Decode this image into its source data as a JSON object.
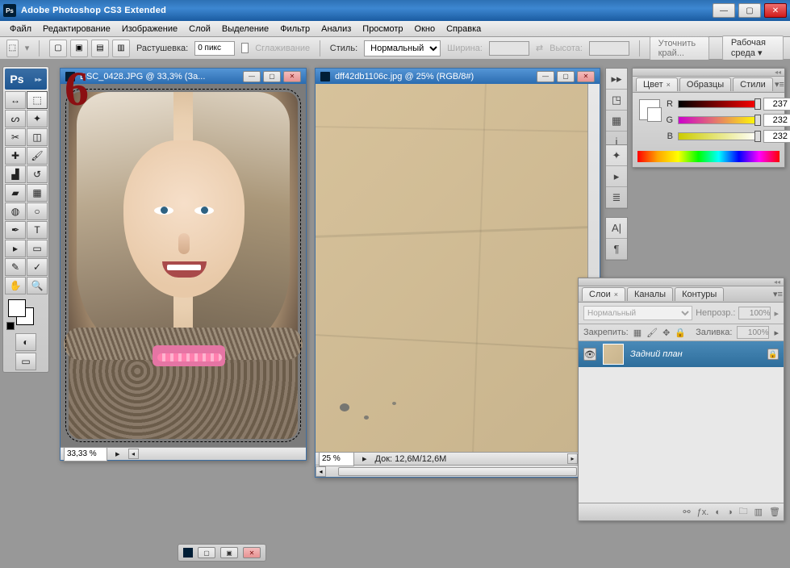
{
  "app": {
    "title": "Adobe Photoshop CS3 Extended",
    "logo": "Ps"
  },
  "menu": [
    "Файл",
    "Редактирование",
    "Изображение",
    "Слой",
    "Выделение",
    "Фильтр",
    "Анализ",
    "Просмотр",
    "Окно",
    "Справка"
  ],
  "options": {
    "feather_label": "Растушевка:",
    "feather_value": "0 пикс",
    "antialias": "Сглаживание",
    "style_label": "Стиль:",
    "style_value": "Нормальный",
    "width_label": "Ширина:",
    "height_label": "Высота:",
    "refine": "Уточнить край...",
    "workspace": "Рабочая среда ▾"
  },
  "tools_header": "Ps",
  "tools": [
    {
      "n": "move-tool",
      "g": "↔"
    },
    {
      "n": "marquee-tool",
      "g": "⬚"
    },
    {
      "n": "lasso-tool",
      "g": "ᔕ"
    },
    {
      "n": "magic-wand-tool",
      "g": "✦"
    },
    {
      "n": "crop-tool",
      "g": "✂"
    },
    {
      "n": "slice-tool",
      "g": "◫"
    },
    {
      "n": "healing-brush-tool",
      "g": "✚"
    },
    {
      "n": "brush-tool",
      "g": "🖌"
    },
    {
      "n": "stamp-tool",
      "g": "▟"
    },
    {
      "n": "history-brush-tool",
      "g": "↺"
    },
    {
      "n": "eraser-tool",
      "g": "▰"
    },
    {
      "n": "gradient-tool",
      "g": "▦"
    },
    {
      "n": "blur-tool",
      "g": "◍"
    },
    {
      "n": "dodge-tool",
      "g": "○"
    },
    {
      "n": "pen-tool",
      "g": "✒"
    },
    {
      "n": "type-tool",
      "g": "T"
    },
    {
      "n": "path-select-tool",
      "g": "▸"
    },
    {
      "n": "shape-tool",
      "g": "▭"
    },
    {
      "n": "notes-tool",
      "g": "✎"
    },
    {
      "n": "eyedropper-tool",
      "g": "✓"
    },
    {
      "n": "hand-tool",
      "g": "✋"
    },
    {
      "n": "zoom-tool",
      "g": "🔍"
    }
  ],
  "doc1": {
    "title": "DSC_0428.JPG @ 33,3% (За...",
    "zoom": "33,33 %"
  },
  "doc2": {
    "title": "dff42db1106c.jpg @ 25% (RGB/8#)",
    "zoom": "25 %",
    "docinfo": "Док: 12,6M/12,6M"
  },
  "annotation": "6",
  "color_panel": {
    "tabs": [
      "Цвет",
      "Образцы",
      "Стили"
    ],
    "r_label": "R",
    "r_value": "237",
    "g_label": "G",
    "g_value": "232",
    "b_label": "B",
    "b_value": "232"
  },
  "layers_panel": {
    "tabs": [
      "Слои",
      "Каналы",
      "Контуры"
    ],
    "blend_mode": "Нормальный",
    "opacity_label": "Непрозр.:",
    "opacity_value": "100%",
    "lock_label": "Закрепить:",
    "fill_label": "Заливка:",
    "fill_value": "100%",
    "layer_name": "Задний план"
  },
  "doccontrols": {
    "min": "—",
    "max": "▢",
    "close": "✕"
  }
}
